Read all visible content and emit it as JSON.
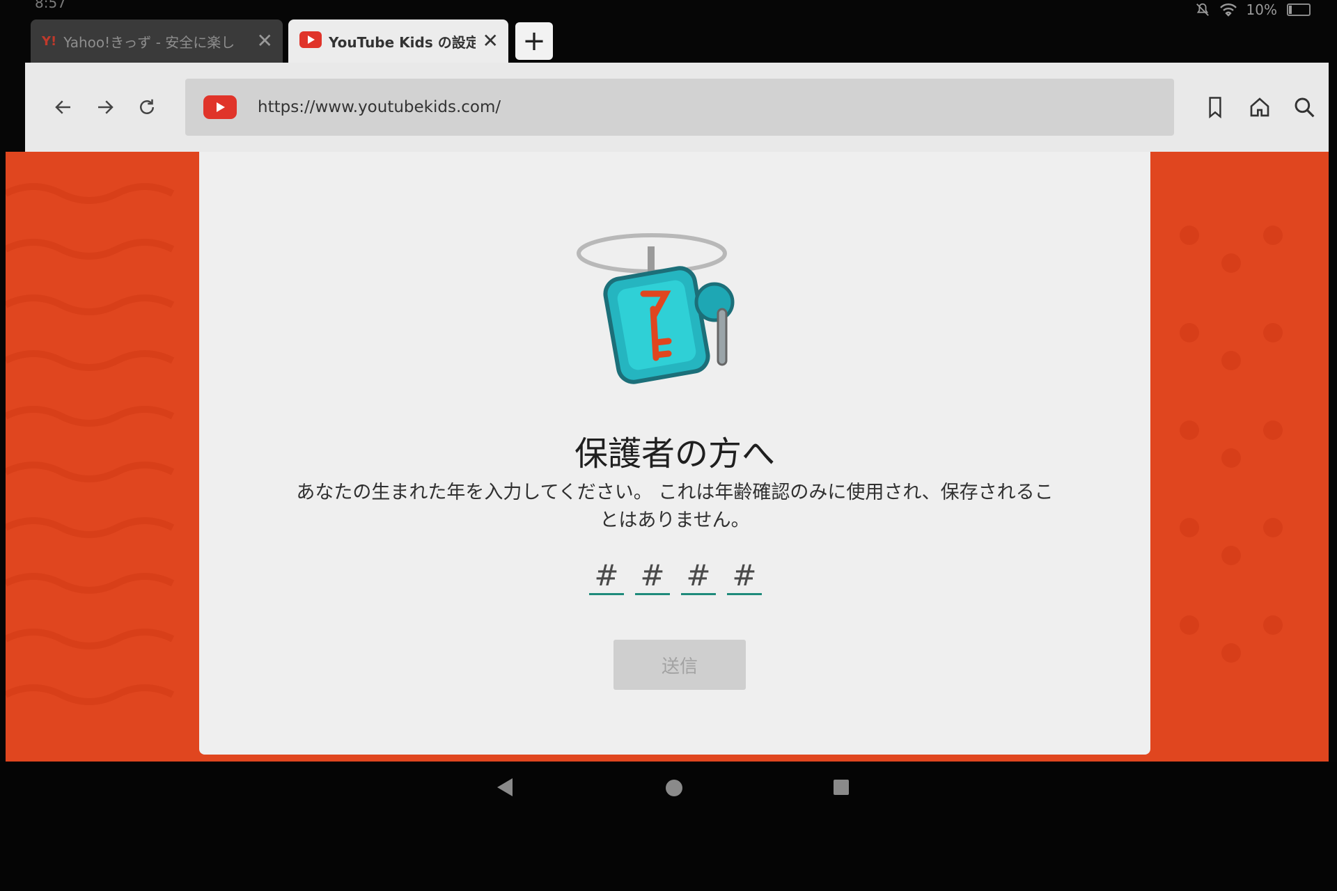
{
  "status": {
    "time": "8:57",
    "battery": "10%"
  },
  "tabs": [
    {
      "favicon": "Y!",
      "title": "Yahoo!きっず - 安全に楽し",
      "close": "✕",
      "active": false
    },
    {
      "favicon": "youtube-icon",
      "title": "YouTube Kids の設定",
      "close": "✕",
      "active": true
    }
  ],
  "new_tab_label": "+",
  "address_bar": {
    "url": "https://www.youtubekids.com/"
  },
  "page": {
    "heading": "保護者の方へ",
    "description": "あなたの生まれた年を入力してください。 これは年齢確認のみに使用され、保存されることはありません。",
    "year_inputs": [
      {
        "placeholder": "#",
        "value": ""
      },
      {
        "placeholder": "#",
        "value": ""
      },
      {
        "placeholder": "#",
        "value": ""
      },
      {
        "placeholder": "#",
        "value": ""
      }
    ],
    "submit_label": "送信"
  },
  "colors": {
    "brand": "#e0461f",
    "accent": "#1e8a7a",
    "youtube_red": "#e0342a"
  }
}
